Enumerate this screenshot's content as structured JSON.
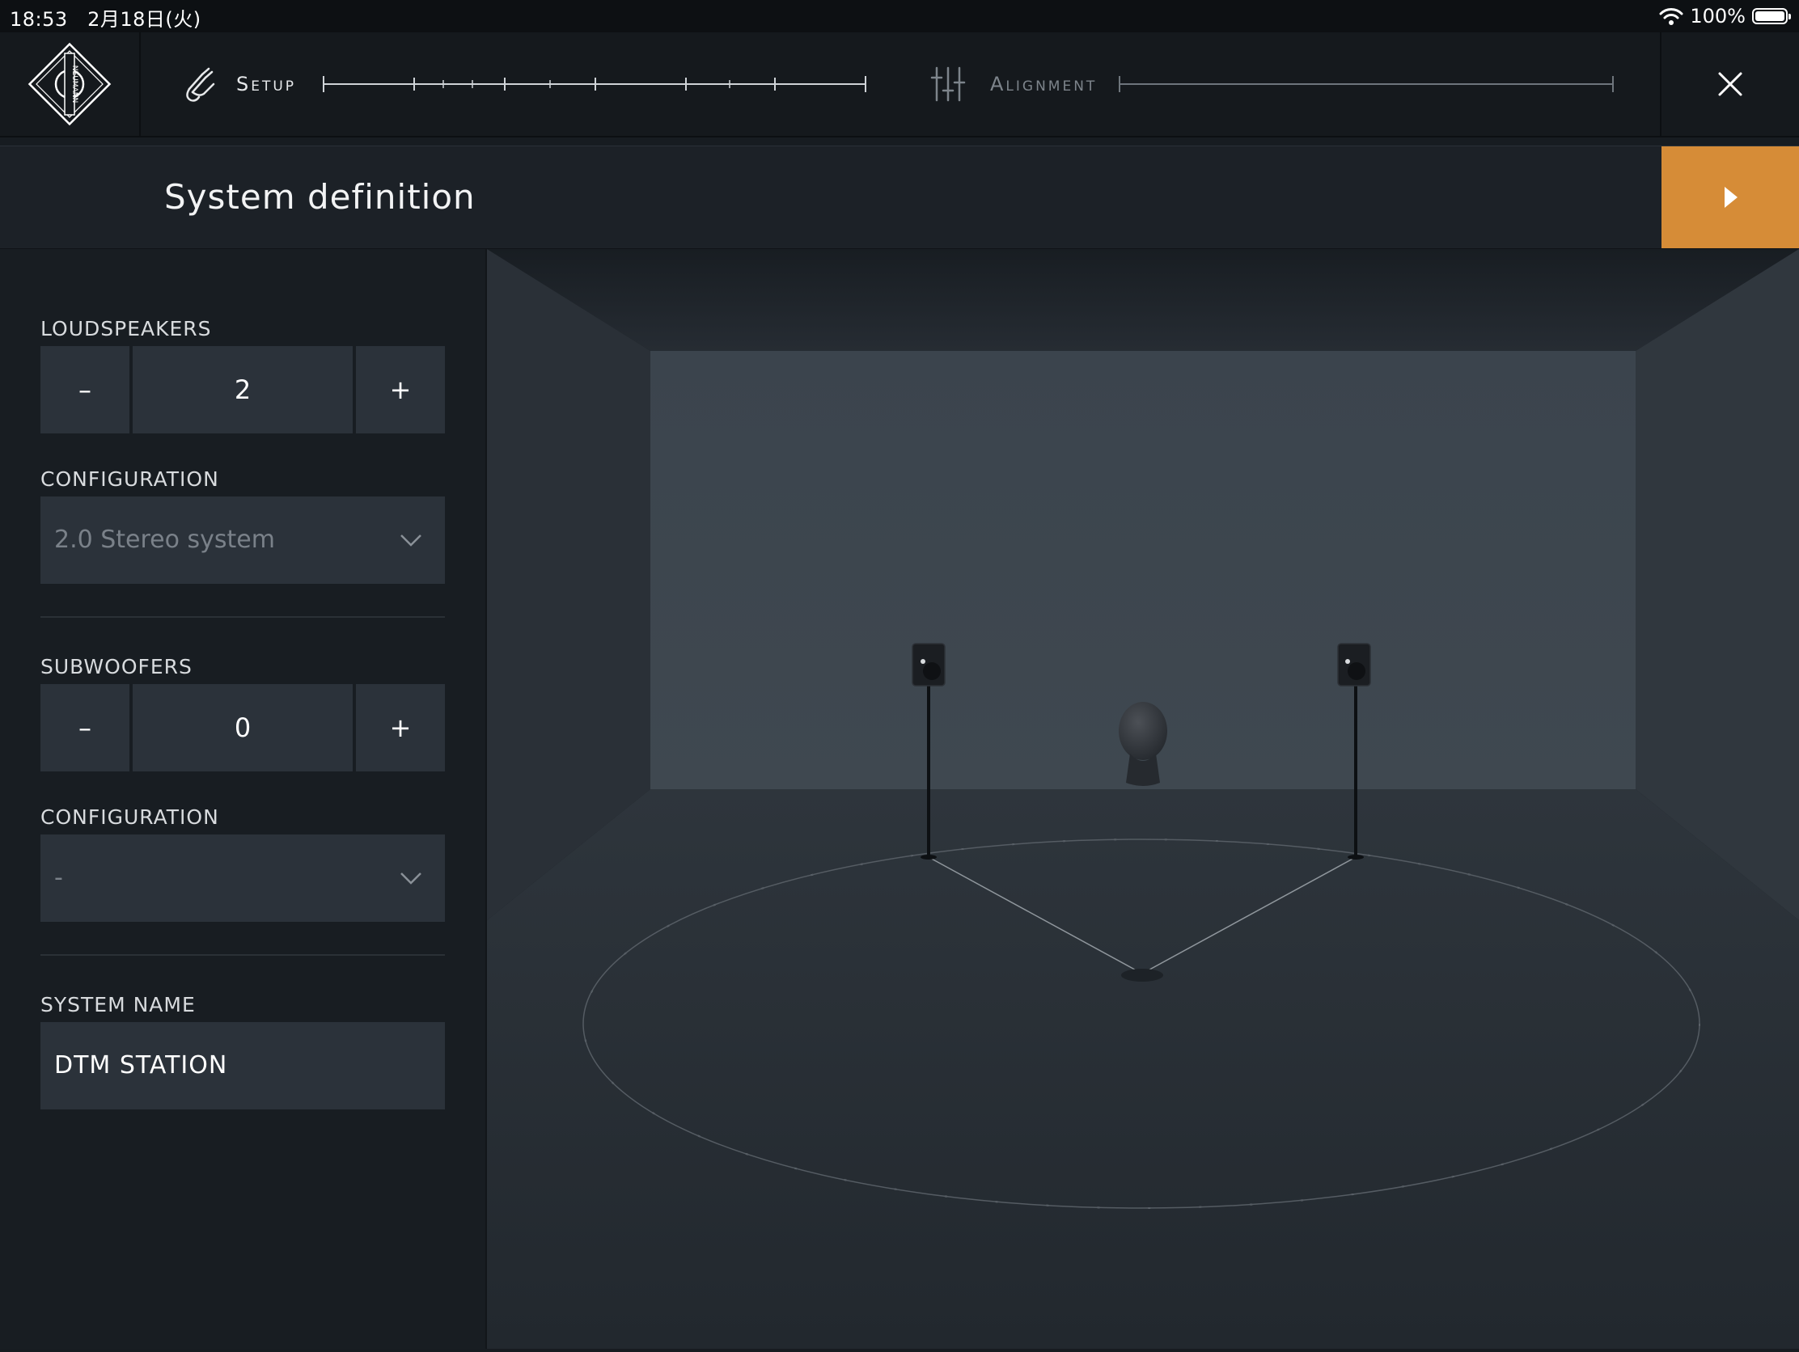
{
  "status": {
    "time": "18:53",
    "date": "2月18日(火)",
    "battery": "100%"
  },
  "nav": {
    "brand": "NEUMANN",
    "steps": [
      {
        "label": "Setup",
        "icon": "cable-icon",
        "state": "active"
      },
      {
        "label": "Alignment",
        "icon": "mixer-sliders-icon",
        "state": "inactive"
      }
    ]
  },
  "header": {
    "title": "System definition"
  },
  "form": {
    "loudspeakers": {
      "label": "LOUDSPEAKERS",
      "minus": "–",
      "value": "2",
      "plus": "+"
    },
    "speaker_config": {
      "label": "CONFIGURATION",
      "value": "2.0 Stereo system"
    },
    "subwoofers": {
      "label": "SUBWOOFERS",
      "minus": "–",
      "value": "0",
      "plus": "+"
    },
    "sub_config": {
      "label": "CONFIGURATION",
      "value": "-"
    },
    "system_name": {
      "label": "SYSTEM NAME",
      "value": "DTM STATION"
    }
  },
  "colors": {
    "accent": "#d68c37",
    "panel": "#181d22",
    "field": "#2b323a"
  }
}
